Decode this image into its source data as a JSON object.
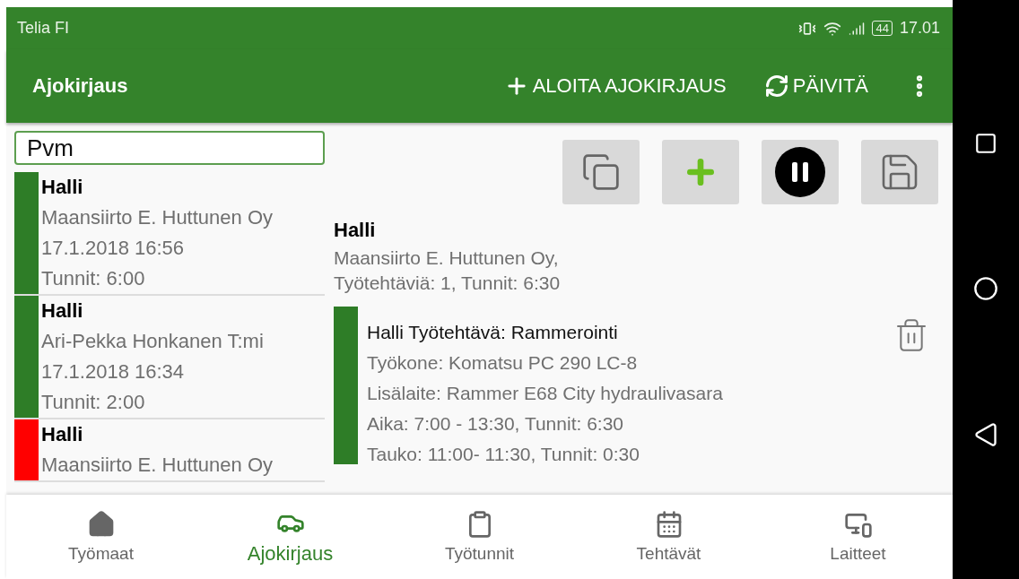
{
  "status_bar": {
    "carrier": "Telia FI",
    "battery": "44",
    "time": "17.01"
  },
  "toolbar": {
    "title": "Ajokirjaus",
    "actions": [
      {
        "kind": "add",
        "label": "ALOITA AJOKIRJAUS"
      },
      {
        "kind": "refresh",
        "label": "PÄIVITÄ"
      }
    ]
  },
  "filter": {
    "value": "Pvm"
  },
  "entries": [
    {
      "title": "Halli",
      "company": "Maansiirto E. Huttunen Oy",
      "date": "17.1.2018 16:56",
      "hours": "Tunnit: 6:00",
      "color": "#2e7d27"
    },
    {
      "title": "Halli",
      "company": "Ari-Pekka Honkanen T:mi",
      "date": "17.1.2018 16:34",
      "hours": "Tunnit: 2:00",
      "color": "#2e7d27"
    },
    {
      "title": "Halli",
      "company": "Maansiirto E. Huttunen Oy",
      "color": "#ff0000"
    }
  ],
  "detail": {
    "title": "Halli",
    "summary": [
      "Maansiirto E. Huttunen Oy,",
      "Työtehtäviä: 1, Tunnit: 6:30"
    ],
    "tasks": [
      {
        "title": "Halli Työtehtävä: Rammerointi",
        "lines": [
          "Työkone: Komatsu PC 290 LC-8",
          "Lisälaite: Rammer E68 City hydraulivasara",
          "Aika: 7:00 - 13:30, Tunnit: 6:30",
          "Tauko: 11:00- 11:30, Tunnit: 0:30"
        ],
        "color": "#2e7d27"
      }
    ]
  },
  "bottom_nav": [
    {
      "label": "Työmaat",
      "selected": false
    },
    {
      "label": "Ajokirjaus",
      "selected": true
    },
    {
      "label": "Työtunnit",
      "selected": false
    },
    {
      "label": "Tehtävät",
      "selected": false
    },
    {
      "label": "Laitteet",
      "selected": false
    }
  ]
}
